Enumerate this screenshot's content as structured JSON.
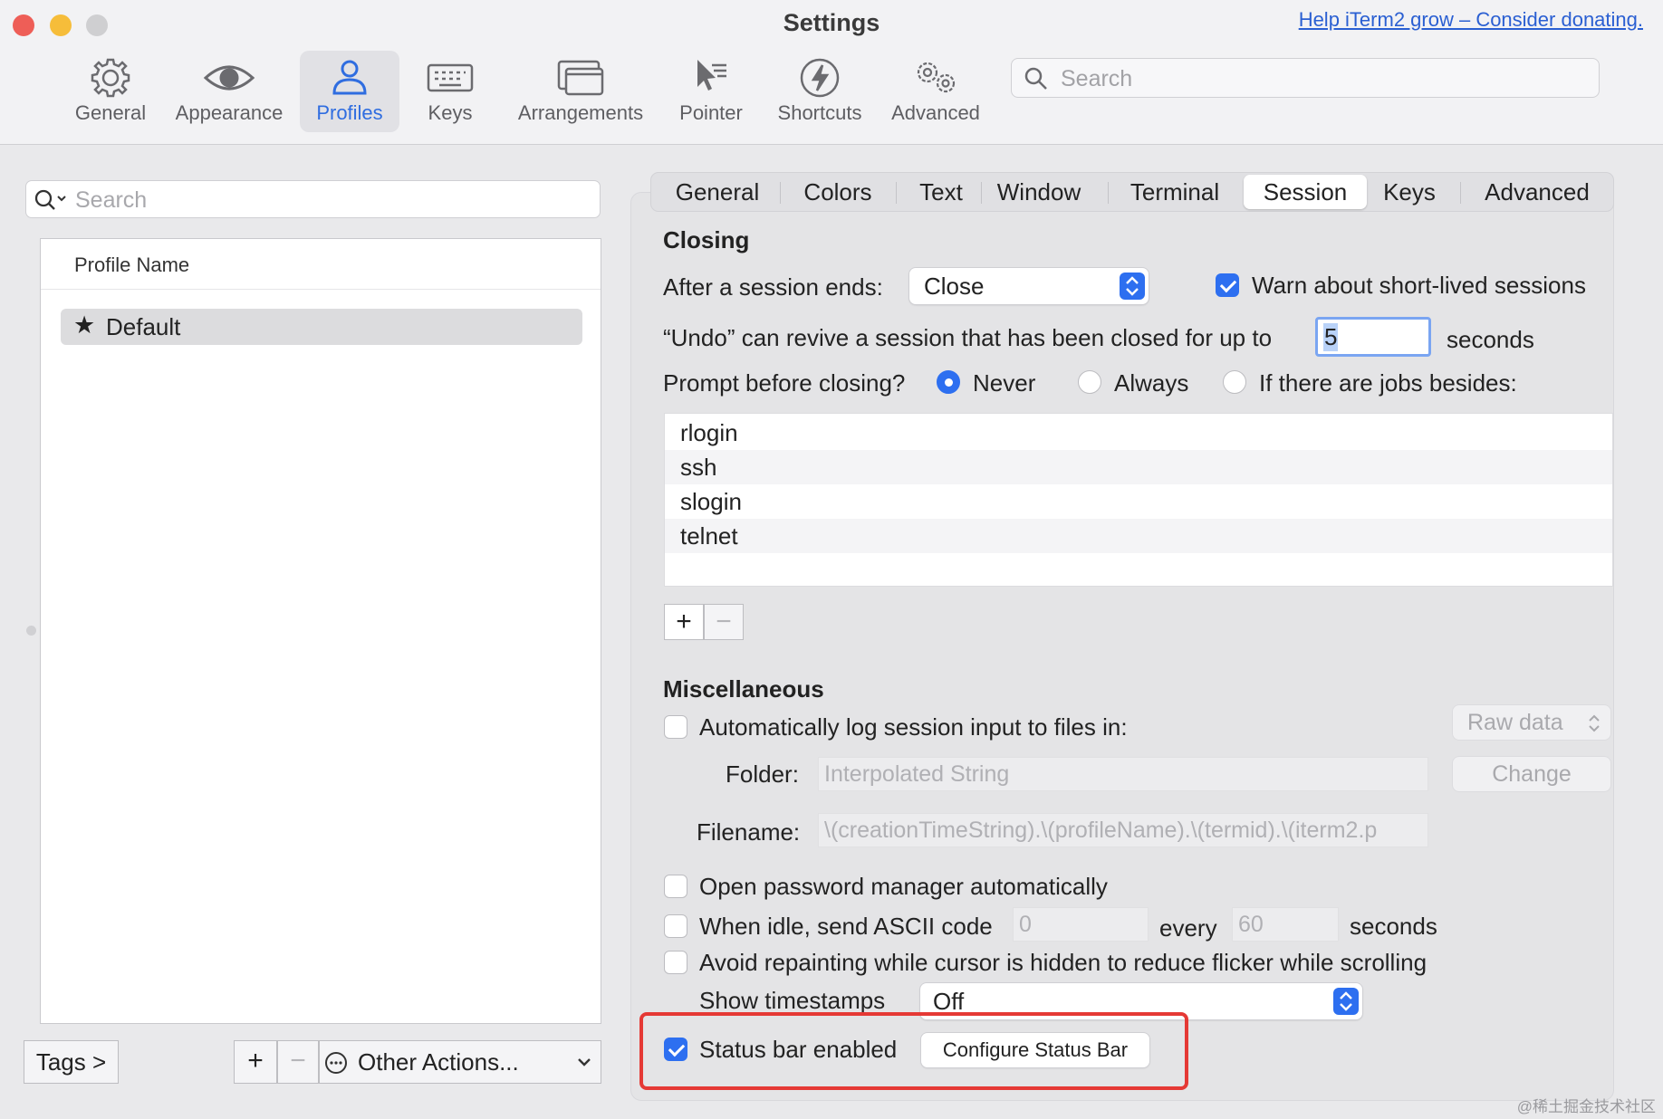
{
  "window": {
    "title": "Settings",
    "donate_link": "Help iTerm2 grow – Consider donating.",
    "traffic_lights": {
      "close": "#ee5e57",
      "minimize": "#f6bd3a",
      "zoom": "#cfcfd1"
    }
  },
  "toolbar": {
    "items": [
      {
        "label": "General",
        "icon": "gear-icon"
      },
      {
        "label": "Appearance",
        "icon": "eye-icon"
      },
      {
        "label": "Profiles",
        "icon": "person-icon",
        "active": true
      },
      {
        "label": "Keys",
        "icon": "keyboard-icon"
      },
      {
        "label": "Arrangements",
        "icon": "windows-icon"
      },
      {
        "label": "Pointer",
        "icon": "pointer-icon"
      },
      {
        "label": "Shortcuts",
        "icon": "bolt-icon"
      },
      {
        "label": "Advanced",
        "icon": "gears-icon"
      }
    ],
    "search_placeholder": "Search"
  },
  "profiles": {
    "search_placeholder": "Search",
    "column_header": "Profile Name",
    "items": [
      {
        "name": "Default",
        "star": "★"
      }
    ],
    "tags_button": "Tags >",
    "add_button": "+",
    "remove_button": "−",
    "other_actions": "Other Actions..."
  },
  "tabs": [
    "General",
    "Colors",
    "Text",
    "Window",
    "Terminal",
    "Session",
    "Keys",
    "Advanced"
  ],
  "active_tab": "Session",
  "closing": {
    "heading": "Closing",
    "after_session_label": "After a session ends:",
    "after_session_value": "Close",
    "warn_short_lived": {
      "label": "Warn about short-lived sessions",
      "checked": true
    },
    "undo_label": "“Undo” can revive a session that has been closed for up to",
    "undo_value": "5",
    "undo_unit": "seconds",
    "prompt_label": "Prompt before closing?",
    "prompt_options": [
      {
        "label": "Never",
        "selected": true
      },
      {
        "label": "Always",
        "selected": false
      },
      {
        "label": "If there are jobs besides:",
        "selected": false
      }
    ],
    "jobs": [
      "rlogin",
      "ssh",
      "slogin",
      "telnet"
    ],
    "add_job": "+",
    "remove_job": "−"
  },
  "misc": {
    "heading": "Miscellaneous",
    "auto_log": {
      "label": "Automatically log session input to files in:",
      "checked": false
    },
    "log_format": "Raw data",
    "folder_label": "Folder:",
    "folder_placeholder": "Interpolated String",
    "change_button": "Change",
    "filename_label": "Filename:",
    "filename_value": "\\(creationTimeString).\\(profileName).\\(termid).\\(iterm2.p",
    "open_password": {
      "label": "Open password manager automatically",
      "checked": false
    },
    "idle_send": {
      "label": "When idle, send ASCII code",
      "checked": false,
      "code": "0",
      "every_label": "every",
      "interval": "60",
      "unit": "seconds"
    },
    "avoid_repaint": {
      "label": "Avoid repainting while cursor is hidden to reduce flicker while scrolling",
      "checked": false
    },
    "timestamps_label": "Show timestamps",
    "timestamps_value": "Off",
    "status_bar": {
      "label": "Status bar enabled",
      "checked": true
    },
    "configure_status_bar": "Configure Status Bar"
  },
  "watermark": "@稀土掘金技术社区",
  "colors": {
    "accent": "#2d6ff0",
    "highlight_box": "#e53935"
  }
}
